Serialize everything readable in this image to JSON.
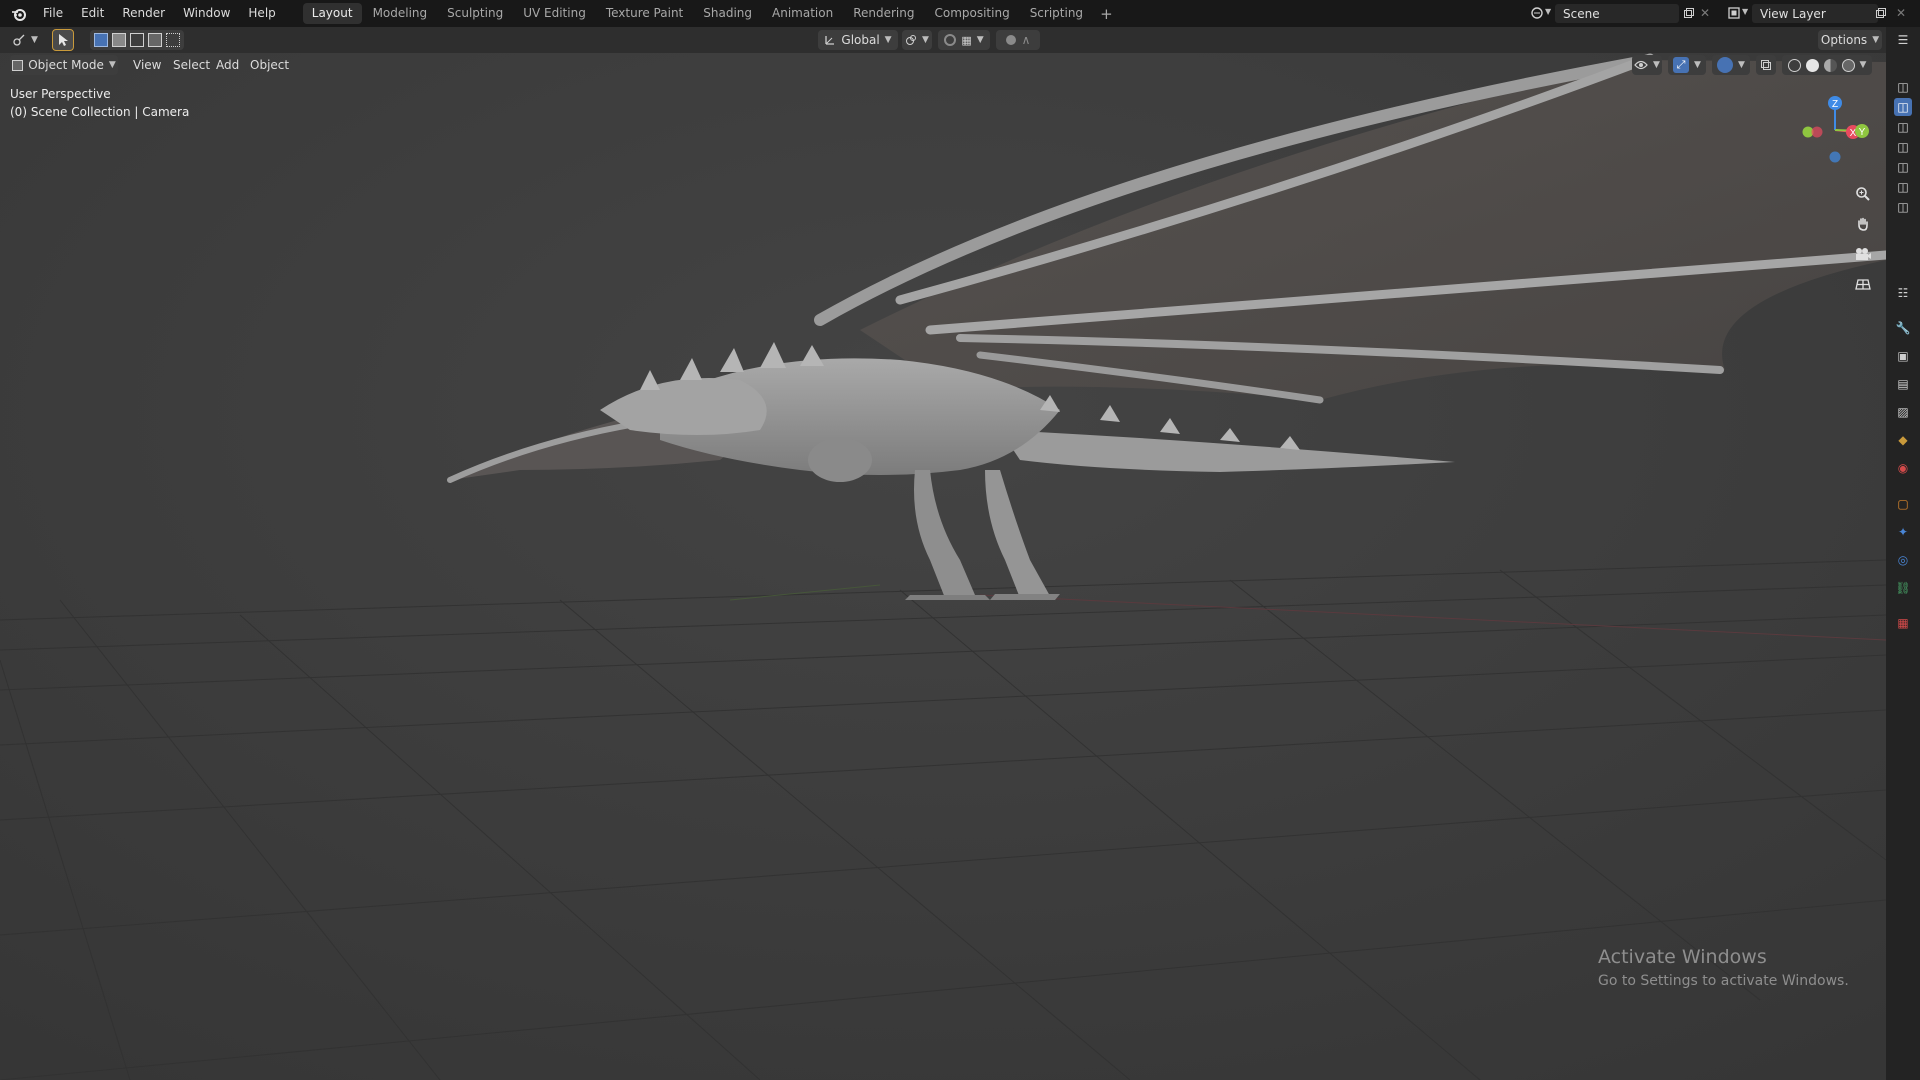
{
  "menu": [
    "File",
    "Edit",
    "Render",
    "Window",
    "Help"
  ],
  "workspaces": [
    {
      "label": "Layout",
      "active": true
    },
    {
      "label": "Modeling",
      "active": false
    },
    {
      "label": "Sculpting",
      "active": false
    },
    {
      "label": "UV Editing",
      "active": false
    },
    {
      "label": "Texture Paint",
      "active": false
    },
    {
      "label": "Shading",
      "active": false
    },
    {
      "label": "Animation",
      "active": false
    },
    {
      "label": "Rendering",
      "active": false
    },
    {
      "label": "Compositing",
      "active": false
    },
    {
      "label": "Scripting",
      "active": false
    }
  ],
  "add_workspace": "+",
  "scene": {
    "name": "Scene",
    "view_layer": "View Layer"
  },
  "header": {
    "transform_orientation": "Global",
    "options_label": "Options",
    "mode": "Object Mode",
    "menus": [
      "View",
      "Select",
      "Add",
      "Object"
    ]
  },
  "viewport": {
    "perspective_label": "User Perspective",
    "collection_label": "(0) Scene Collection | Camera",
    "gizmo_axes": [
      "Z",
      "X",
      "Y"
    ]
  },
  "watermark": {
    "title": "Activate Windows",
    "subtitle": "Go to Settings to activate Windows."
  },
  "colors": {
    "accent": "#4772b3",
    "axis_x": "#e84a5f",
    "axis_y": "#8fc640",
    "axis_z": "#3f8be6",
    "topbar_bg": "#181818",
    "viewport_bg": "#3c3c3c"
  },
  "icons": {
    "blender_logo": "blender-logo-icon",
    "select_tool": "select-box-icon",
    "zoom": "zoom-icon",
    "pan": "hand-icon",
    "camera_view": "camera-icon",
    "grid_view": "grid-icon"
  }
}
